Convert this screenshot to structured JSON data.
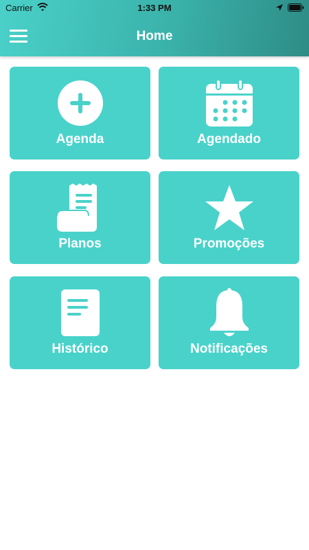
{
  "status_bar": {
    "carrier": "Carrier",
    "time": "1:33 PM"
  },
  "header": {
    "title": "Home"
  },
  "tiles": [
    {
      "label": "Agenda",
      "icon": "plus-circle-icon"
    },
    {
      "label": "Agendado",
      "icon": "calendar-icon"
    },
    {
      "label": "Planos",
      "icon": "receipt-icon"
    },
    {
      "label": "Promoções",
      "icon": "star-icon"
    },
    {
      "label": "Histórico",
      "icon": "document-icon"
    },
    {
      "label": "Notificações",
      "icon": "bell-icon"
    }
  ],
  "colors": {
    "accent": "#49d2ca",
    "header_start": "#4ad1c9",
    "header_end": "#2e8c86"
  }
}
